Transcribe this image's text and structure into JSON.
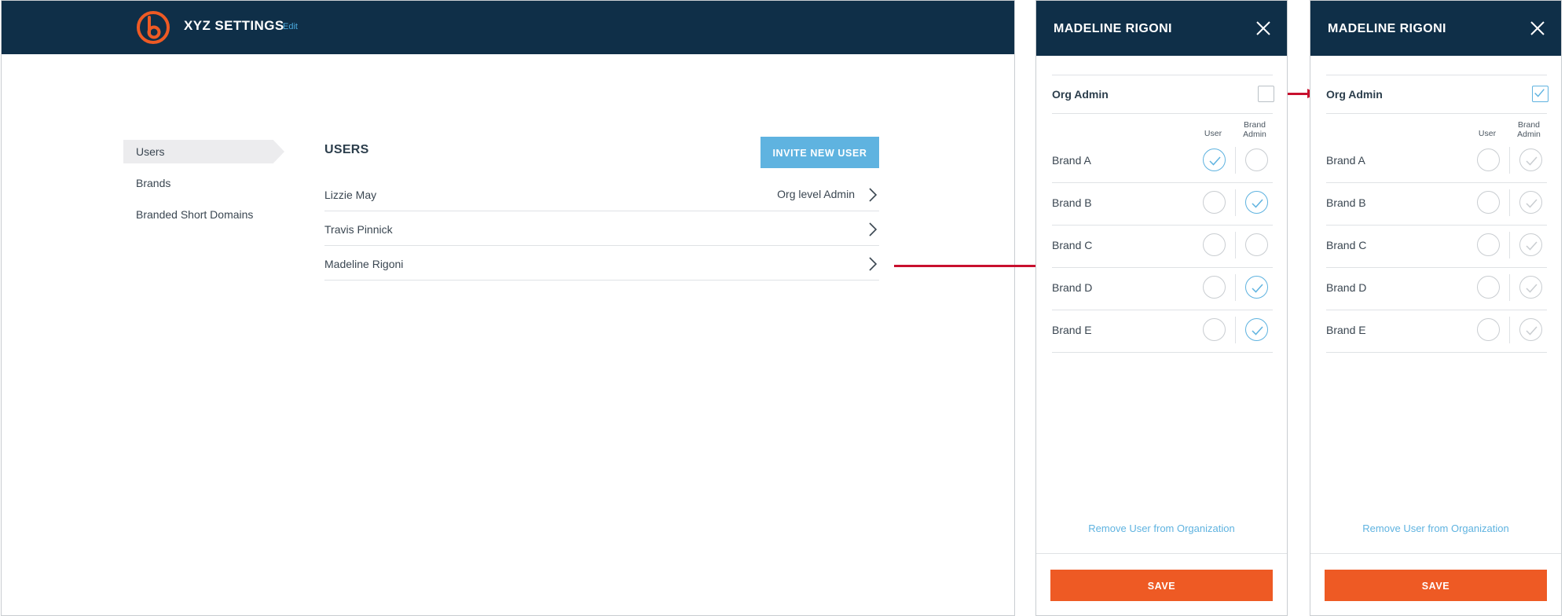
{
  "colors": {
    "header": "#0f2f48",
    "accent": "#5fb3e0",
    "save": "#ee5a24",
    "arrow": "#c8102e",
    "logo": "#ee5a24"
  },
  "app": {
    "title": "XYZ SETTINGS",
    "edit_label": "Edit"
  },
  "sidebar": {
    "items": [
      {
        "label": "Users",
        "active": true
      },
      {
        "label": "Brands",
        "active": false
      },
      {
        "label": "Branded Short Domains",
        "active": false
      }
    ]
  },
  "users": {
    "heading": "USERS",
    "invite_label": "INVITE NEW USER",
    "rows": [
      {
        "name": "Lizzie May",
        "role": "Org level Admin"
      },
      {
        "name": "Travis Pinnick",
        "role": ""
      },
      {
        "name": "Madeline Rigoni",
        "role": ""
      }
    ]
  },
  "panels": [
    {
      "title": "MADELINE RIGONI",
      "org_admin_label": "Org Admin",
      "org_admin_checked": false,
      "col_user": "User",
      "col_brand_admin_1": "Brand",
      "col_brand_admin_2": "Admin",
      "brands": [
        {
          "name": "Brand A",
          "user": true,
          "admin": false
        },
        {
          "name": "Brand B",
          "user": false,
          "admin": true
        },
        {
          "name": "Brand C",
          "user": false,
          "admin": false
        },
        {
          "name": "Brand D",
          "user": false,
          "admin": true
        },
        {
          "name": "Brand E",
          "user": false,
          "admin": true
        }
      ],
      "remove_label": "Remove User from Organization",
      "save_label": "SAVE"
    },
    {
      "title": "MADELINE RIGONI",
      "org_admin_label": "Org Admin",
      "org_admin_checked": true,
      "col_user": "User",
      "col_brand_admin_1": "Brand",
      "col_brand_admin_2": "Admin",
      "brands": [
        {
          "name": "Brand A",
          "user": false,
          "admin": true
        },
        {
          "name": "Brand B",
          "user": false,
          "admin": true
        },
        {
          "name": "Brand C",
          "user": false,
          "admin": true
        },
        {
          "name": "Brand D",
          "user": false,
          "admin": true
        },
        {
          "name": "Brand E",
          "user": false,
          "admin": true
        }
      ],
      "remove_label": "Remove User from Organization",
      "save_label": "SAVE"
    }
  ]
}
